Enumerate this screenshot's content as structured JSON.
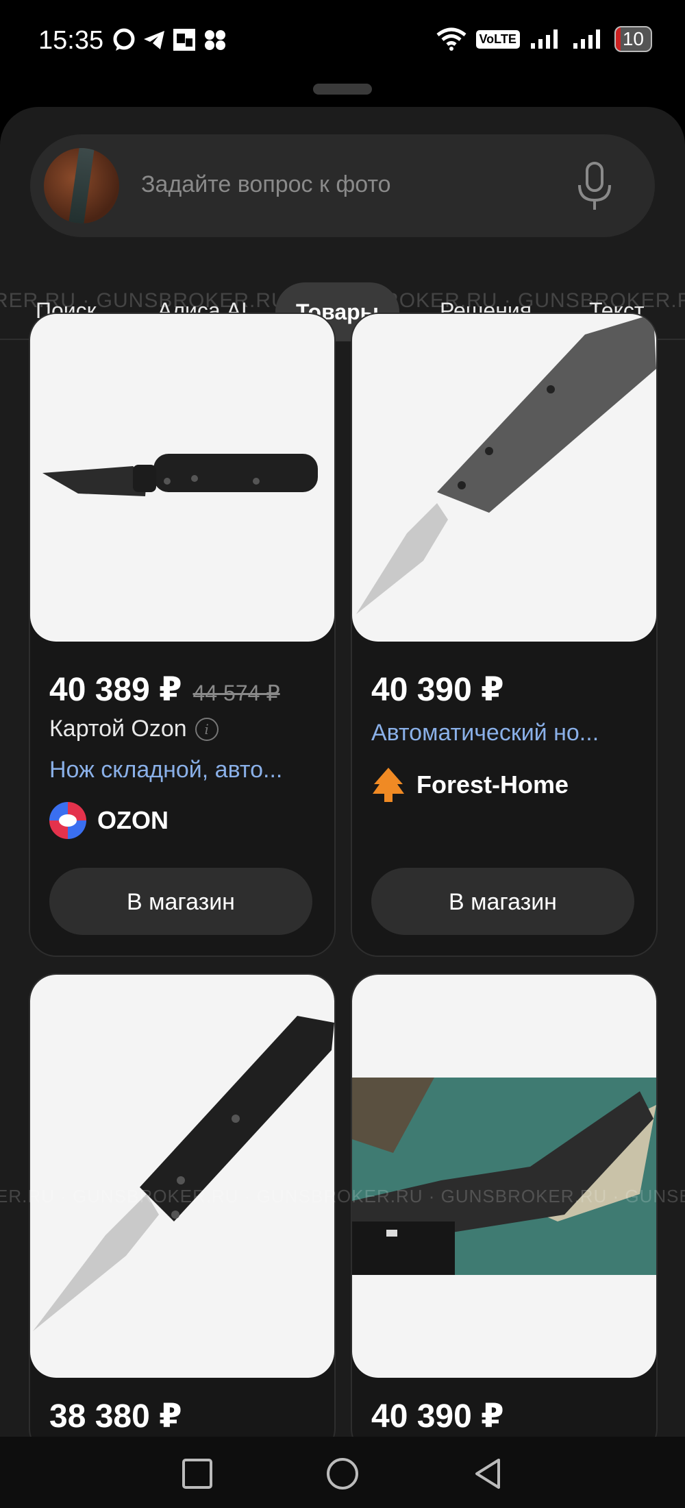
{
  "status_bar": {
    "time": "15:35",
    "volte": "VoLTE",
    "battery": "10"
  },
  "search": {
    "placeholder": "Задайте вопрос к фото"
  },
  "tabs": {
    "items": [
      {
        "label": "Поиск"
      },
      {
        "label": "Алиса AI"
      },
      {
        "label": "Товары"
      },
      {
        "label": "Решения"
      },
      {
        "label": "Текст"
      }
    ],
    "active": "Товары",
    "watermark": "RER.RU · GUNSBROKER.RU · GUNSBROKER.RU · GUNSBROKER.RU · GUNSBROKER.RU · GUNSBROKER.RU"
  },
  "products": [
    {
      "price": "40 389 ₽",
      "old_price": "44 574 ₽",
      "payment": "Картой Ozon",
      "title": "Нож складной, авто...",
      "shop": "OZON",
      "button": "В магазин"
    },
    {
      "price": "40 390 ₽",
      "title": "Автоматический но...",
      "shop": "Forest-Home",
      "button": "В магазин"
    },
    {
      "price": "38 380 ₽"
    },
    {
      "price": "40 390 ₽"
    }
  ],
  "image_watermark": "ER.RU · GUNSBROKER.RU · GUNSBROKER.RU · GUNSBROKER.RU · GUNSBROKER.RU",
  "colors": {
    "background": "#1c1c1c",
    "link": "#8ab0e8",
    "button": "#2e2e2e"
  }
}
